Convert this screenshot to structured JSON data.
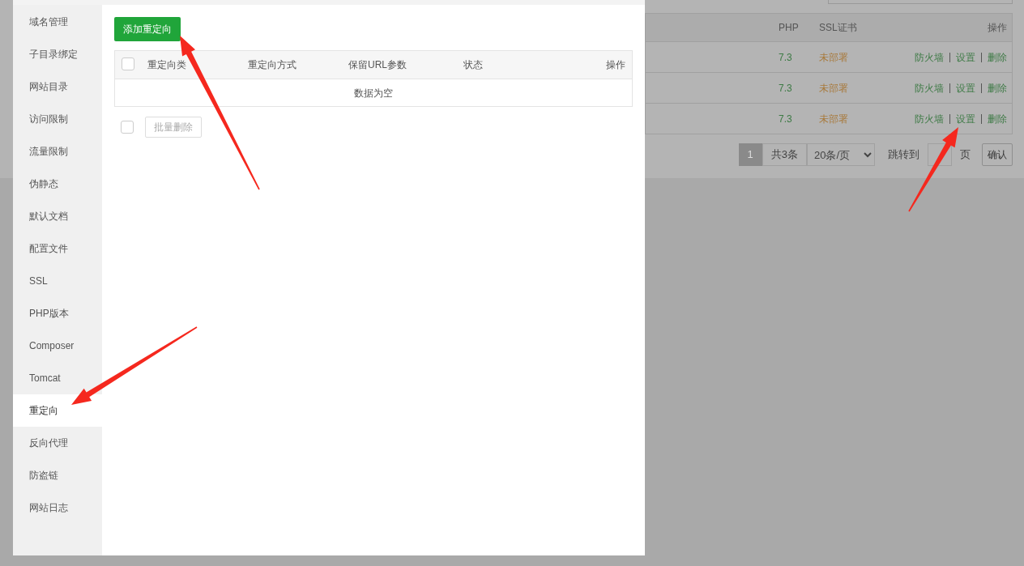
{
  "background_page": {
    "table": {
      "columns": [
        "PHP",
        "SSL证书",
        "操作"
      ],
      "rows": [
        {
          "php": "7.3",
          "ssl": "未部署",
          "actions": [
            "防火墙",
            "设置",
            "删除"
          ]
        },
        {
          "php": "7.3",
          "ssl": "未部署",
          "actions": [
            "防火墙",
            "设置",
            "删除"
          ]
        },
        {
          "php": "7.3",
          "ssl": "未部署",
          "actions": [
            "防火墙",
            "设置",
            "删除"
          ]
        }
      ]
    },
    "pagination": {
      "current": "1",
      "total": "共3条",
      "page_size": "20条/页",
      "jump_label": "跳转到",
      "page_unit": "页",
      "confirm": "确认"
    }
  },
  "dialog": {
    "sidebar": {
      "items": [
        {
          "label": "域名管理",
          "selected": false
        },
        {
          "label": "子目录绑定",
          "selected": false
        },
        {
          "label": "网站目录",
          "selected": false
        },
        {
          "label": "访问限制",
          "selected": false
        },
        {
          "label": "流量限制",
          "selected": false
        },
        {
          "label": "伪静态",
          "selected": false
        },
        {
          "label": "默认文档",
          "selected": false
        },
        {
          "label": "配置文件",
          "selected": false
        },
        {
          "label": "SSL",
          "selected": false
        },
        {
          "label": "PHP版本",
          "selected": false
        },
        {
          "label": "Composer",
          "selected": false
        },
        {
          "label": "Tomcat",
          "selected": false
        },
        {
          "label": "重定向",
          "selected": true
        },
        {
          "label": "反向代理",
          "selected": false
        },
        {
          "label": "防盗链",
          "selected": false
        },
        {
          "label": "网站日志",
          "selected": false
        }
      ]
    },
    "add_button": "添加重定向",
    "table": {
      "select_all_checked": false,
      "columns": [
        "重定向类",
        "重定向方式",
        "保留URL参数",
        "状态",
        "操作"
      ],
      "empty_text": "数据为空"
    },
    "batch_checked": false,
    "batch_delete": "批量删除"
  }
}
